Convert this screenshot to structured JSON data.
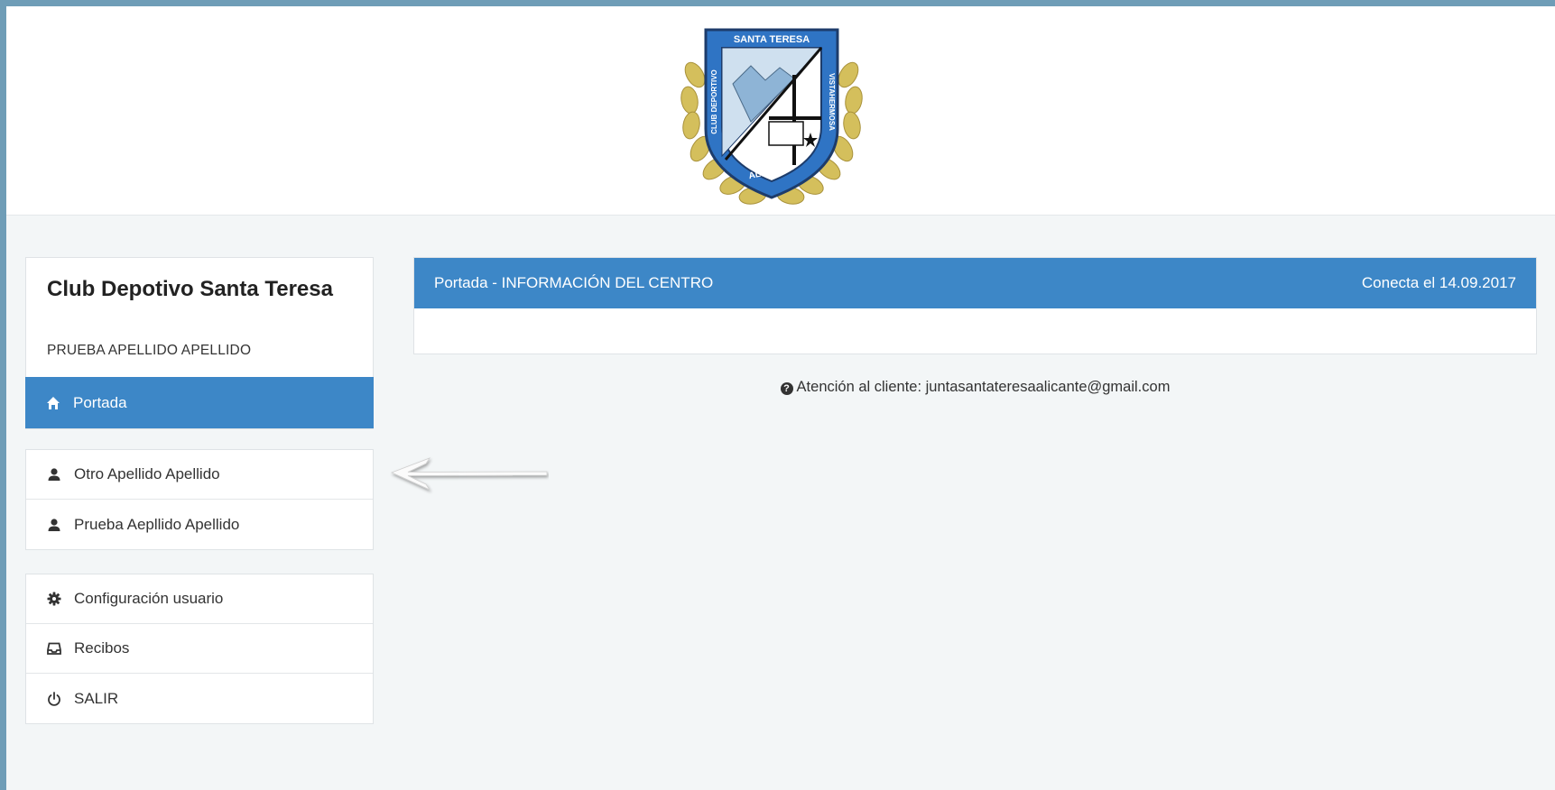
{
  "header": {
    "logo": {
      "name": "club-crest-logo",
      "text_top": "SANTA TERESA",
      "text_left": "CLUB DEPORTIVO",
      "text_right": "VISTAHERMOSA",
      "text_bottom": "ALICANTE"
    }
  },
  "sidebar": {
    "club_name": "Club Depotivo Santa Teresa",
    "user_name": "PRUEBA APELLIDO APELLIDO",
    "active_item": {
      "icon": "home-icon",
      "label": "Portada"
    },
    "members": [
      {
        "icon": "user-icon",
        "label": "Otro Apellido Apellido"
      },
      {
        "icon": "user-icon",
        "label": "Prueba Aepllido Apellido"
      }
    ],
    "settings": [
      {
        "icon": "gear-icon",
        "label": "Configuración usuario"
      },
      {
        "icon": "inbox-icon",
        "label": "Recibos"
      },
      {
        "icon": "power-icon",
        "label": "SALIR"
      }
    ]
  },
  "main": {
    "panel_title": "Portada - INFORMACIÓN DEL CENTRO",
    "panel_right": "Conecta el 14.09.2017",
    "contact": "Atención al cliente: juntasantateresaalicante@gmail.com"
  },
  "colors": {
    "accent": "#3d87c7",
    "background": "#f3f6f7",
    "frame": "#6f9db7"
  }
}
